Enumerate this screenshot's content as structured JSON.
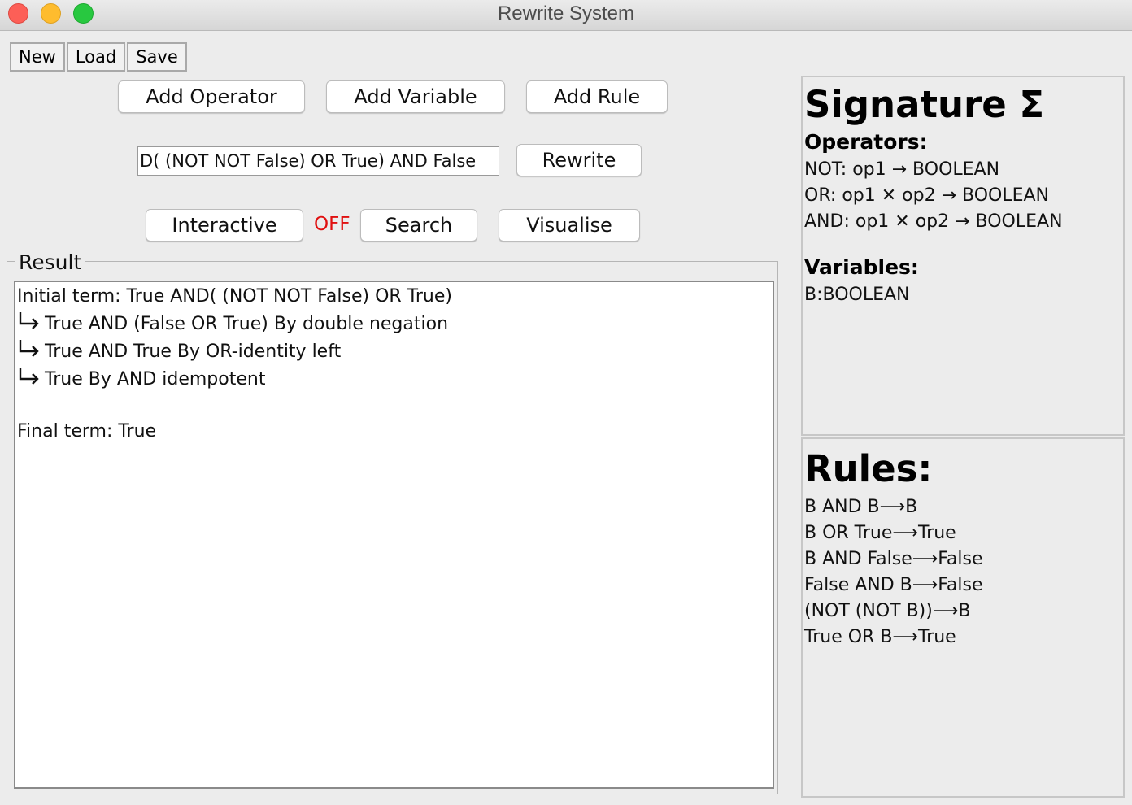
{
  "window": {
    "title": "Rewrite System"
  },
  "file_menu": {
    "new": "New",
    "load": "Load",
    "save": "Save"
  },
  "toolbar": {
    "add_operator": "Add Operator",
    "add_variable": "Add Variable",
    "add_rule": "Add Rule"
  },
  "term": {
    "value": "D( (NOT NOT False) OR True) AND False",
    "rewrite": "Rewrite"
  },
  "controls": {
    "interactive": "Interactive",
    "interactive_state": "OFF",
    "interactive_state_color": "#e01010",
    "search": "Search",
    "visualise": "Visualise"
  },
  "result": {
    "legend": "Result",
    "initial": "Initial term: True AND( (NOT NOT False) OR True)",
    "arrow_icon": "return-arrow-icon",
    "steps": [
      "True AND (False OR True) By double negation",
      "True AND True By OR-identity left",
      "True By AND idempotent"
    ],
    "final": "Final term: True"
  },
  "signature": {
    "title": "Signature Σ",
    "operators_label": "Operators:",
    "operators": [
      "NOT: op1 → BOOLEAN",
      "OR: op1 ✕ op2 → BOOLEAN",
      "AND: op1 ✕ op2 → BOOLEAN"
    ],
    "variables_label": "Variables:",
    "variables": [
      "B:BOOLEAN"
    ]
  },
  "rules": {
    "title": "Rules:",
    "items": [
      "B AND B⟶B",
      "B OR True⟶True",
      "B AND False⟶False",
      "False AND B⟶False",
      "(NOT (NOT B))⟶B",
      "True OR B⟶True"
    ]
  }
}
